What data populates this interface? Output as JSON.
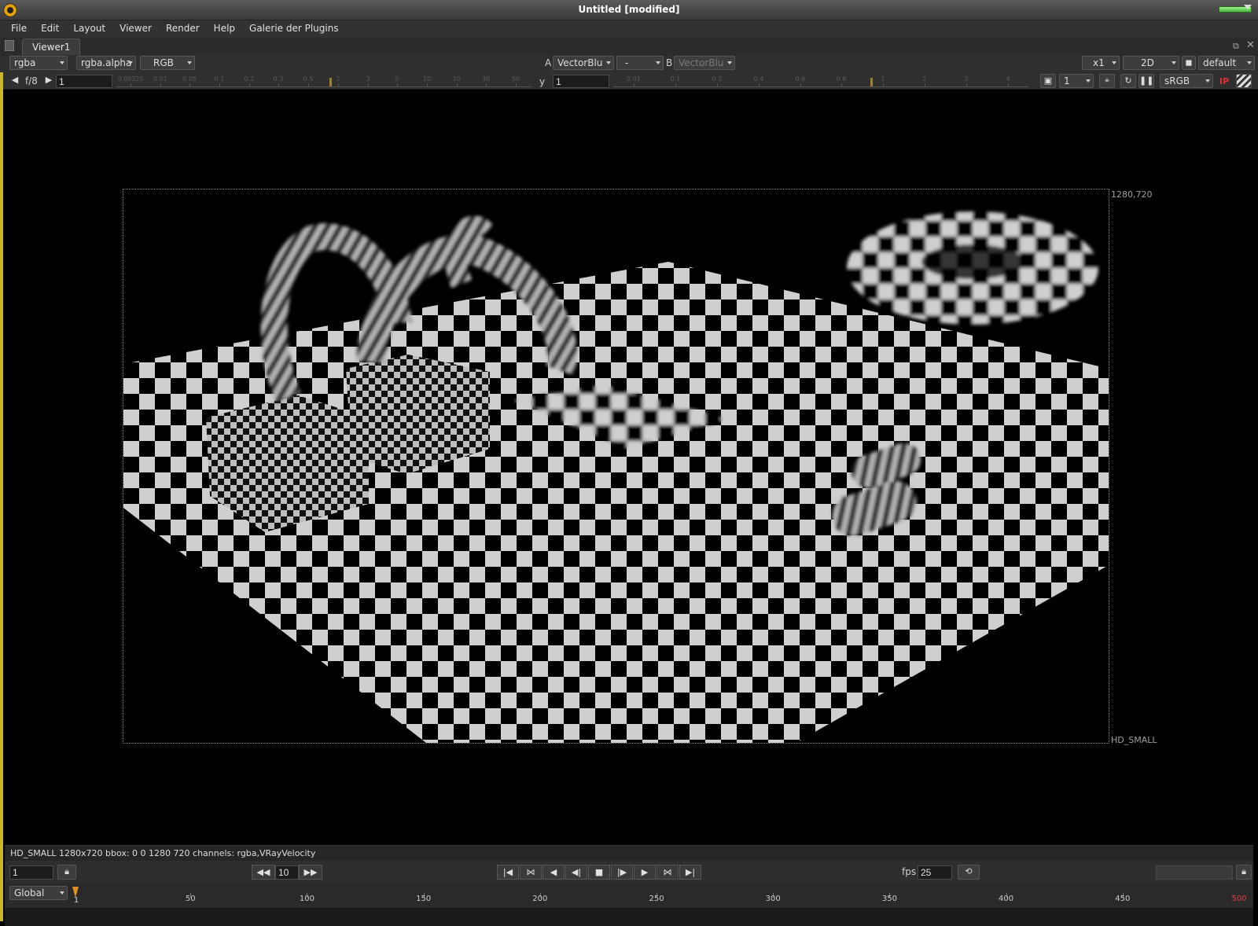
{
  "window": {
    "title": "Untitled [modified]"
  },
  "menu": [
    "File",
    "Edit",
    "Layout",
    "Viewer",
    "Render",
    "Help",
    "Galerie der Plugins"
  ],
  "tab": {
    "label": "Viewer1"
  },
  "toolbar": {
    "channels": "rgba",
    "alpha_channel": "rgba.alpha",
    "display": "RGB",
    "a_label": "A",
    "a_input": "VectorBlu",
    "operation": "-",
    "b_label": "B",
    "b_input": "VectorBlu",
    "zoom": "x1",
    "view_mode": "2D",
    "lut": "default",
    "fstop": "f/8",
    "gain_value": "1",
    "gamma_label": "y",
    "gamma_value": "1",
    "proxy_value": "1",
    "colorspace": "sRGB",
    "ip_label": "IP",
    "gain_ticks": [
      "0.00325",
      "0.01",
      "0.05",
      "0.1",
      "0.2",
      "0.3",
      "0.5",
      "2",
      "3",
      "5",
      "10",
      "20",
      "30",
      "50"
    ],
    "gamma_ticks": [
      "0.01",
      "0.1",
      "0.2",
      "0.4",
      "0.6",
      "0.8",
      "1",
      "2",
      "3",
      "4"
    ]
  },
  "viewer": {
    "resolution_label": "1280,720",
    "format_label": "HD_SMALL",
    "info_text": "HD_SMALL 1280x720 bbox: 0 0 1280 720 channels: rgba,VRayVelocity"
  },
  "playback": {
    "current_frame": "1",
    "increment": "10",
    "fps_label": "fps",
    "fps_value": "25"
  },
  "timeline": {
    "range_mode": "Global",
    "start": "1",
    "end": "500",
    "ticks": [
      "50",
      "100",
      "150",
      "200",
      "250",
      "300",
      "350",
      "400",
      "450"
    ]
  },
  "icons": {
    "first_frame": "skip-to-start-icon",
    "prev_keyframe": "previous-keyframe-icon",
    "prev_frame": "step-back-icon",
    "play_backward": "play-backward-icon",
    "stop": "stop-icon",
    "play_forward": "play-forward-icon",
    "next_frame": "step-forward-icon",
    "next_keyframe": "next-keyframe-icon",
    "last_frame": "skip-to-end-icon"
  }
}
